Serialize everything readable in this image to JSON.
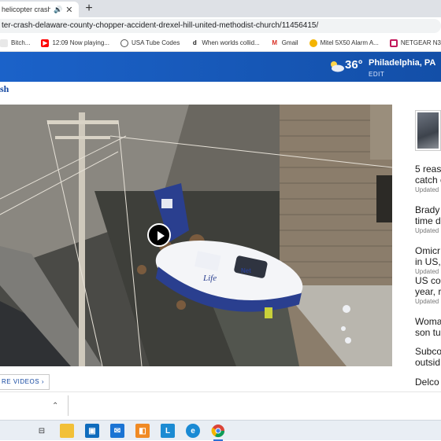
{
  "browser": {
    "tab_title": "helicopter crash: ",
    "new_tab_label": "+",
    "url": "ter-crash-delaware-county-chopper-accident-drexel-hill-united-methodist-church/11456415/"
  },
  "bookmarks": [
    {
      "label": "Bitch...",
      "icon": "bookmark-icon",
      "color": "#5f6368"
    },
    {
      "label": "12:09 Now playing...",
      "icon": "youtube-icon",
      "color": "#ff0000"
    },
    {
      "label": "USA Tube Codes",
      "icon": "globe-icon",
      "color": "#555555"
    },
    {
      "label": "When worlds collid...",
      "icon": "d-icon",
      "color": "#222222"
    },
    {
      "label": "Gmail",
      "icon": "gmail-icon",
      "color": "#d93025"
    },
    {
      "label": "Mitel 5X50 Alarm A...",
      "icon": "bulb-icon",
      "color": "#f4b400"
    },
    {
      "label": "NETGEAR N300 WiF...",
      "icon": "netgear-icon",
      "color": "#c2185b"
    }
  ],
  "site": {
    "header_color": "#1357bb",
    "weather": {
      "temp": "36°",
      "city": "Philadelphia, PA",
      "edit": "EDIT"
    },
    "crumb": "sh",
    "more_videos": "RE VIDEOS"
  },
  "video": {
    "state": "paused",
    "play_label": "play"
  },
  "sidebar": {
    "stories": [
      {
        "line1": "5 reas",
        "line2": "catch c",
        "updated": "Updated"
      },
      {
        "line1": "Brady",
        "line2": "time d",
        "updated": "Updated"
      },
      {
        "line1": "Omicr",
        "line2": "in US,",
        "updated": "Updated"
      },
      {
        "line1": "US co",
        "line2": "year, r",
        "updated": "Updated"
      },
      {
        "line1": "Woma",
        "line2": "son tu",
        "updated": ""
      },
      {
        "line1": "Subco",
        "line2": "outsid",
        "updated": ""
      },
      {
        "line1": "Delco",
        "line2": "",
        "updated": ""
      }
    ]
  },
  "taskbar": {
    "apps": [
      {
        "name": "task-view-icon",
        "label": "",
        "color": "#4a4a4a"
      },
      {
        "name": "file-explorer-icon",
        "label": "",
        "color": "#f2c037"
      },
      {
        "name": "store-icon",
        "label": "",
        "color": "#0f6cbd"
      },
      {
        "name": "mail-icon",
        "label": "",
        "color": "#1b74d4"
      },
      {
        "name": "app-orange-icon",
        "label": "",
        "color": "#f08a24"
      },
      {
        "name": "l-app-icon",
        "label": "L",
        "color": "#1c8bd3"
      },
      {
        "name": "edge-icon",
        "label": "",
        "color": "#1a8ad4"
      },
      {
        "name": "chrome-icon",
        "label": "",
        "color": "#db4437"
      }
    ]
  }
}
